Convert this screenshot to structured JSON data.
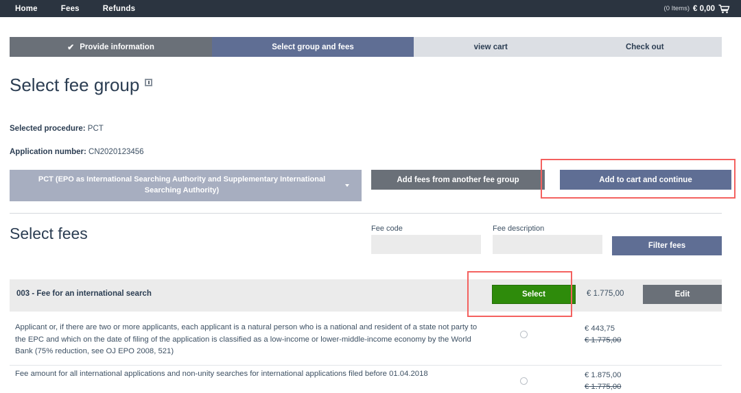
{
  "topbar": {
    "nav": [
      {
        "label": "Home"
      },
      {
        "label": "Fees"
      },
      {
        "label": "Refunds"
      }
    ],
    "cart": {
      "items_label": "(0 Items)",
      "total": "€ 0,00",
      "icon": "shopping-cart-icon"
    }
  },
  "steps": [
    {
      "label": "Provide information",
      "state": "done",
      "check": "✔"
    },
    {
      "label": "Select group and fees",
      "state": "active"
    },
    {
      "label": "view cart",
      "state": "todo"
    },
    {
      "label": "Check out",
      "state": "todo"
    }
  ],
  "page": {
    "title": "Select fee group",
    "info_icon": "info-icon"
  },
  "meta": {
    "procedure_label": "Selected procedure:",
    "procedure_value": "PCT",
    "application_label": "Application number:",
    "application_value": "CN2020123456"
  },
  "group_row": {
    "dropdown_label": "PCT (EPO as International Searching Authority and Supplementary International Searching Authority)",
    "another_group_label": "Add fees from another fee group",
    "add_to_cart_label": "Add to cart and continue"
  },
  "fees_section": {
    "title": "Select fees",
    "filters": {
      "code_label": "Fee code",
      "code_value": "",
      "code_placeholder": "",
      "description_label": "Fee description",
      "description_value": "",
      "description_placeholder": "",
      "filter_button_label": "Filter fees"
    },
    "fee_header": {
      "title": "003 - Fee for an international search",
      "select_label": "Select",
      "price": "€ 1.775,00",
      "edit_label": "Edit"
    },
    "options": [
      {
        "description": "Applicant or, if there are two or more applicants, each applicant is a natural person who is a national and resident of a state not party to the EPC and which on the date of filing of the application is classified as a low-income or lower-middle-income economy by the World Bank (75% reduction, see OJ EPO 2008, 521)",
        "price": "€ 443,75",
        "price_original": "€ 1.775,00",
        "selected": false
      },
      {
        "description": "Fee amount for all international applications and non-unity searches for international applications filed before 01.04.2018",
        "price": "€ 1.875,00",
        "price_original": "€ 1.775,00",
        "selected": false
      }
    ]
  },
  "annotations": {
    "highlight_color": "#f4605e",
    "boxes": [
      "add-to-cart-and-continue",
      "select-button"
    ]
  }
}
